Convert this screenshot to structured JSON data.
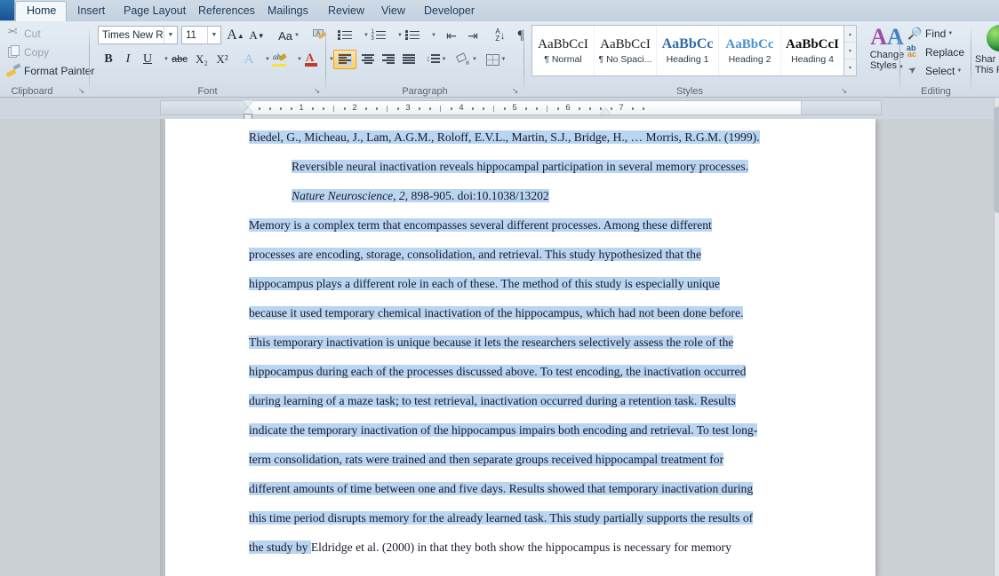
{
  "app": {
    "name": "Microsoft Word"
  },
  "tabs": [
    {
      "label": "Home",
      "active": true
    },
    {
      "label": "Insert",
      "active": false
    },
    {
      "label": "Page Layout",
      "active": false
    },
    {
      "label": "References",
      "active": false
    },
    {
      "label": "Mailings",
      "active": false
    },
    {
      "label": "Review",
      "active": false
    },
    {
      "label": "View",
      "active": false
    },
    {
      "label": "Developer",
      "active": false
    }
  ],
  "groups": {
    "clipboard": {
      "label": "Clipboard",
      "cut": "Cut",
      "copy": "Copy",
      "format_painter": "Format Painter",
      "launcher": "↘"
    },
    "font": {
      "label": "Font",
      "font_name": "Times New Rom",
      "font_size": "11",
      "grow_font": "A",
      "shrink_font": "A",
      "change_case": "Aa",
      "clear_formatting": "὘",
      "bold": "B",
      "italic": "I",
      "underline": "U",
      "strikethrough": "abc",
      "subscript": "X₂",
      "superscript": "X²",
      "text_effects": "A",
      "highlight": "ab",
      "font_color": "A",
      "launcher": "↘"
    },
    "paragraph": {
      "label": "Paragraph",
      "bullets": "bullets-icon",
      "numbering": "numbering-icon",
      "multilevel": "multilevel-list-icon",
      "decrease_indent": "decrease-indent-icon",
      "increase_indent": "increase-indent-icon",
      "sort": "A\nZ",
      "show_marks": "¶",
      "align_left": "align-left",
      "align_center": "align-center",
      "align_right": "align-right",
      "justify": "justify",
      "line_spacing": "line-spacing",
      "shading": "shading",
      "borders": "borders",
      "launcher": "↘"
    },
    "styles": {
      "label": "Styles",
      "items": [
        {
          "sample": "AaBbCcI",
          "name": "¶ Normal",
          "kind": "normal"
        },
        {
          "sample": "AaBbCcI",
          "name": "¶ No Spaci...",
          "kind": "normal"
        },
        {
          "sample": "AaBbCс",
          "name": "Heading 1",
          "kind": "h1"
        },
        {
          "sample": "AaBbCc",
          "name": "Heading 2",
          "kind": "h2"
        },
        {
          "sample": "AaBbCcI",
          "name": "Heading 4",
          "kind": "h4"
        }
      ],
      "scroll_up": "▴",
      "scroll_down": "▾",
      "more": "▾",
      "change_styles_line1": "Change",
      "change_styles_line2": "Styles",
      "change_styles_icon_a1": "A",
      "change_styles_icon_a2": "A",
      "launcher": "↘"
    },
    "editing": {
      "label": "Editing",
      "find": "Find",
      "replace": "Replace",
      "select": "Select"
    },
    "share": {
      "line1": "Shar",
      "line2": "This F"
    }
  },
  "ruler": {
    "numbers": [
      "1",
      "2",
      "3",
      "4",
      "5",
      "6",
      "7"
    ],
    "left_indent_inches": 0,
    "right_indent_inches": 6.5
  },
  "document": {
    "paragraphs": [
      {
        "style": "hanging-reference",
        "lines": [
          {
            "text": "Riedel, G., Micheau, J., Lam, A.G.M., Roloff, E.V.L., Martin, S.J., Bridge, H., … Morris, R.G.M. (1999).",
            "indent": false,
            "selected": true
          },
          {
            "text": "Reversible neural inactivation reveals hippocampal participation in several memory processes.",
            "indent": true,
            "selected": true
          },
          {
            "text": "Nature Neuroscience, 2, 898-905. doi:10.1038/13202",
            "indent": true,
            "selected": true,
            "italic_prefix": "Nature Neuroscience, 2,"
          }
        ]
      },
      {
        "style": "body",
        "lines": [
          {
            "text": "Memory is a complex term that encompasses several different processes.  Among these different",
            "indent": false,
            "selected": true
          },
          {
            "text": "processes are encoding, storage, consolidation, and retrieval.  This study hypothesized that the",
            "indent": false,
            "selected": true
          },
          {
            "text": "hippocampus plays a different role in each of these.  The method of this study is especially unique",
            "indent": false,
            "selected": true
          },
          {
            "text": "because it used temporary chemical inactivation of the hippocampus, which had not been done before.",
            "indent": false,
            "selected": true
          },
          {
            "text": "This temporary inactivation is unique because it lets the researchers selectively assess the role of the",
            "indent": false,
            "selected": true
          },
          {
            "text": "hippocampus during each of the processes discussed above.  To test encoding, the inactivation occurred",
            "indent": false,
            "selected": true
          },
          {
            "text": "during learning of a maze task; to test retrieval, inactivation occurred during a retention task.  Results",
            "indent": false,
            "selected": true
          },
          {
            "text": "indicate the temporary inactivation of the hippocampus impairs both encoding and retrieval.  To test long-",
            "indent": false,
            "selected": true
          },
          {
            "text": "term consolidation, rats were trained and then separate groups received hippocampal treatment for",
            "indent": false,
            "selected": true
          },
          {
            "text": "different amounts of time between one and five days.  Results showed that temporary inactivation during",
            "indent": false,
            "selected": true
          },
          {
            "text": "this time period disrupts memory for the already learned task.  This study partially supports the results of",
            "indent": false,
            "selected": true
          },
          {
            "text": "the study by Eldridge et al. (2000) in that they both show the hippocampus is necessary for memory",
            "indent": false,
            "selected": "partial",
            "selected_prefix": "the study by "
          }
        ]
      }
    ]
  },
  "colors": {
    "selection_highlight": "#b9d5f0",
    "ribbon_background": "#dde6ef",
    "active_tab": "#f3f7fa",
    "accent_orange": "#ffcf63",
    "heading1_blue": "#2f6ba5",
    "heading2_blue": "#4a90c9",
    "workspace_gray": "#cbd0d5",
    "page_white": "#ffffff"
  }
}
